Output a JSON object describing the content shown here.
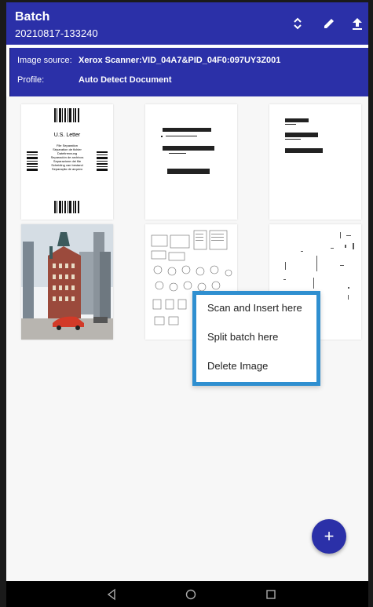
{
  "appbar": {
    "title": "Batch",
    "subtitle": "20210817-133240",
    "icons": [
      "sort-icon",
      "edit-icon",
      "upload-icon"
    ]
  },
  "info": {
    "source_label": "Image source:",
    "source_value": "Xerox Scanner:VID_04A7&PID_04F0:097UY3Z001",
    "profile_label": "Profile:",
    "profile_value": "Auto Detect Document"
  },
  "thumbnails": {
    "page1": {
      "heading": "U.S. Letter",
      "lines": [
        "File Separation",
        "Séparation de fichier",
        "Dateitrennung",
        "Separación de archivos",
        "Separazione dei file",
        "Scheiding van bestand",
        "Separação de arquivo"
      ]
    }
  },
  "context_menu": {
    "items": [
      "Scan and Insert here",
      "Split batch here",
      "Delete Image"
    ]
  },
  "fab": {
    "label": "+"
  },
  "colors": {
    "primary": "#2b30a8",
    "highlight": "#2f8fd0"
  }
}
